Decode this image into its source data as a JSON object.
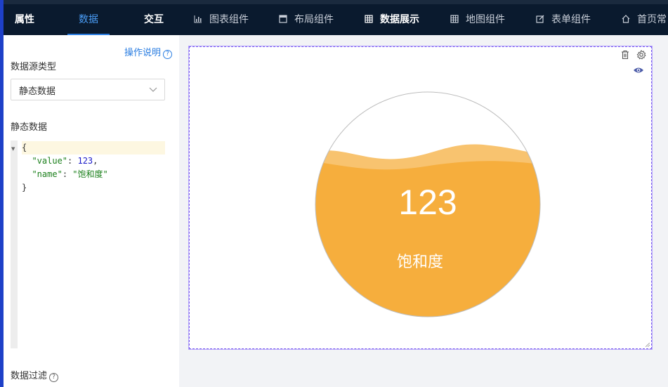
{
  "tabs": {
    "props": "属性",
    "data": "数据",
    "interact": "交互"
  },
  "nav": {
    "chart": "图表组件",
    "layout": "布局组件",
    "display": "数据展示",
    "map": "地图组件",
    "form": "表单组件",
    "home": "首页常"
  },
  "panel": {
    "help": "操作说明",
    "help_q": "?",
    "source_type_label": "数据源类型",
    "source_type_value": "静态数据",
    "static_label": "静态数据",
    "filter_label": "数据过滤",
    "filter_q": "?"
  },
  "code": {
    "open": "{",
    "key1": "\"value\"",
    "colon": ": ",
    "val1": "123",
    "comma": ",",
    "key2": "\"name\"",
    "val2": "\"饱和度\"",
    "close": "}"
  },
  "gauge": {
    "value": "123",
    "name": "饱和度",
    "fill_level": 0.75,
    "colors": {
      "fill": "#f6ae3d",
      "wave_light": "#f8c36f",
      "ring": "#bdbdbd"
    }
  },
  "colors": {
    "accent": "#2a7de1",
    "topbar": "#0a1a2e",
    "selection": "#7b5cf0"
  }
}
